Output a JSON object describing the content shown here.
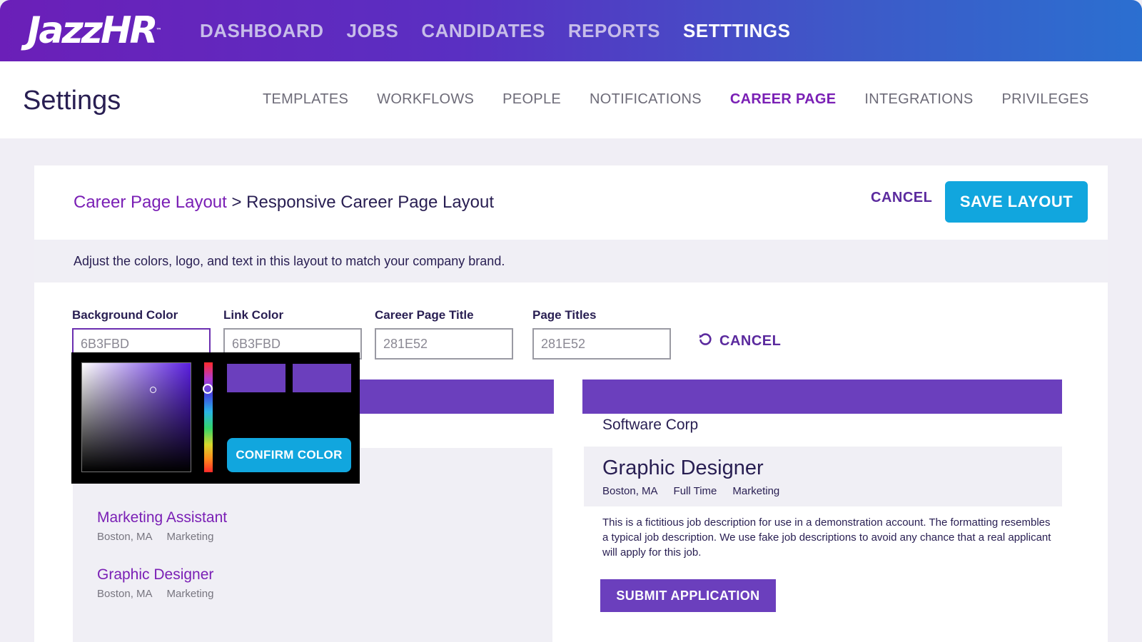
{
  "brand": {
    "logo_text": "JazzHR",
    "logo_tm": "™"
  },
  "topnav": {
    "items": [
      {
        "label": "DASHBOARD"
      },
      {
        "label": "JOBS"
      },
      {
        "label": "CANDIDATES"
      },
      {
        "label": "REPORTS"
      },
      {
        "label": "SETTTINGS",
        "active": true
      }
    ]
  },
  "settings": {
    "title": "Settings",
    "tabs": [
      {
        "label": "TEMPLATES"
      },
      {
        "label": "WORKFLOWS"
      },
      {
        "label": "PEOPLE"
      },
      {
        "label": "NOTIFICATIONS"
      },
      {
        "label": "CAREER PAGE",
        "active": true
      },
      {
        "label": "INTEGRATIONS"
      },
      {
        "label": "PRIVILEGES"
      }
    ]
  },
  "layout_editor": {
    "breadcrumb_parent": "Career Page Layout",
    "breadcrumb_sep": ">",
    "breadcrumb_current": "Responsive Career Page Layout",
    "cancel_label": "CANCEL",
    "save_label": "SAVE LAYOUT",
    "hint": "Adjust the colors, logo, and text in this layout to match your company brand.",
    "fields": [
      {
        "label": "Background Color",
        "value": "6B3FBD"
      },
      {
        "label": "Link Color",
        "value": "6B3FBD"
      },
      {
        "label": "Career Page Title",
        "value": "281E52"
      },
      {
        "label": "Page Titles",
        "value": "281E52"
      }
    ],
    "reset_cancel_label": "CANCEL",
    "picker": {
      "confirm_label": "CONFIRM COLOR"
    }
  },
  "preview_left": {
    "jobs": [
      {
        "title": "Marketing Assistant",
        "location": "Boston, MA",
        "department": "Marketing"
      },
      {
        "title": "Graphic Designer",
        "location": "Boston, MA",
        "department": "Marketing"
      }
    ]
  },
  "preview_right": {
    "company": "Software Corp",
    "job_title": "Graphic Designer",
    "location": "Boston, MA",
    "type": "Full Time",
    "department": "Marketing",
    "description": "This is a fictitious job description for use in a demonstration account. The formatting resembles a typical job description. We use fake job descriptions to avoid any chance that a real applicant will apply for this job.",
    "submit_label": "SUBMIT APPLICATION"
  },
  "colors": {
    "brand_purple": "#6b3fbd",
    "title_navy": "#281e52",
    "accent_blue": "#11a6de",
    "link_purple": "#7a1fb5"
  }
}
